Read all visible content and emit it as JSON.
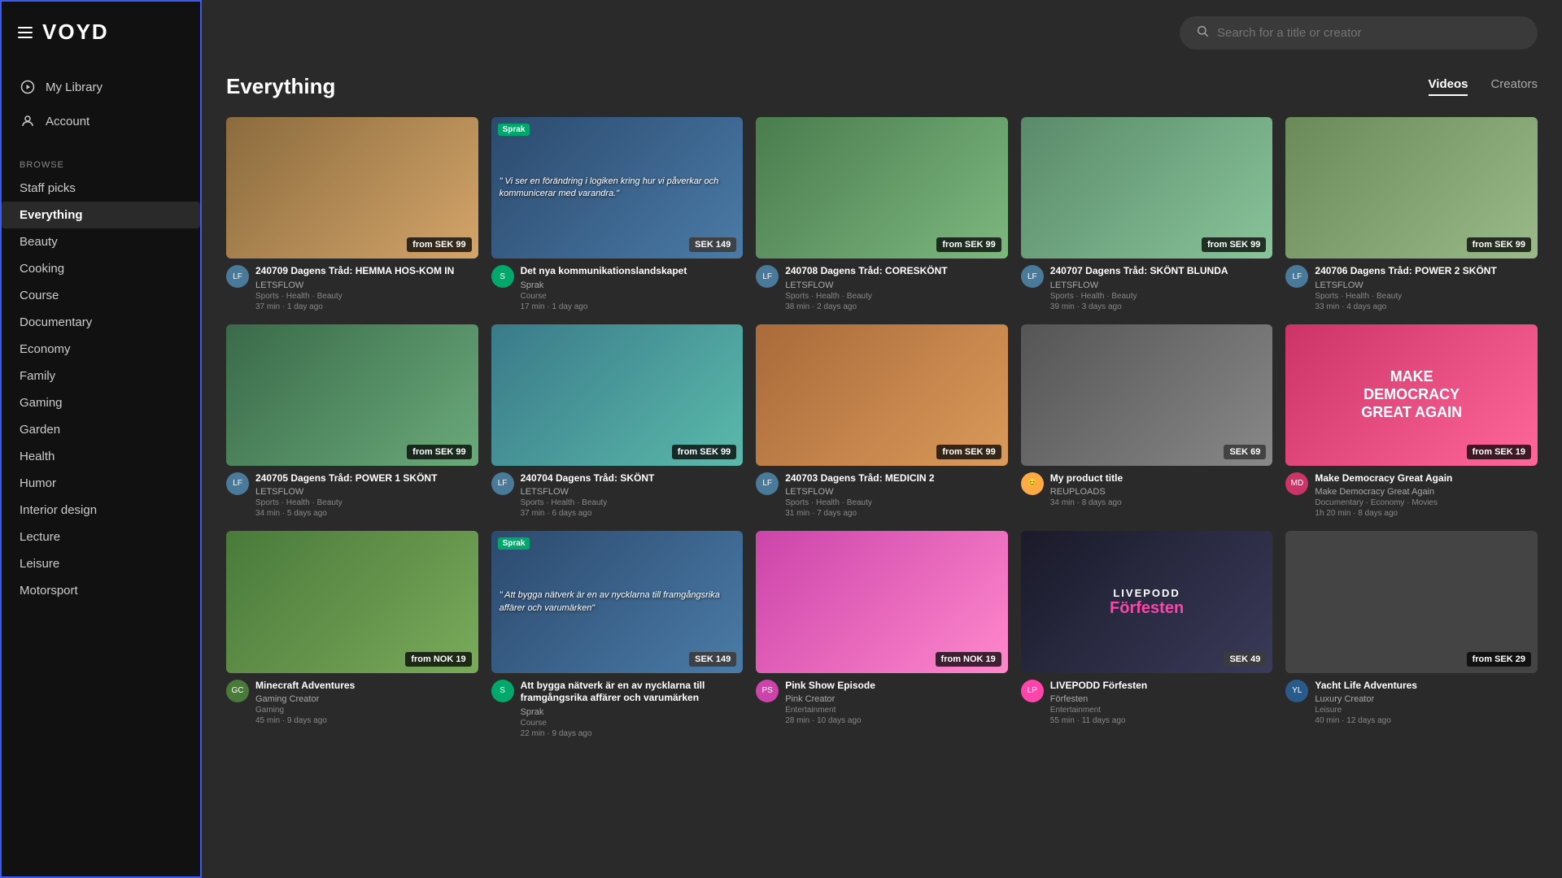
{
  "sidebar": {
    "logo": "VOYD",
    "nav": [
      {
        "id": "my-library",
        "label": "My Library",
        "icon": "play-circle"
      },
      {
        "id": "account",
        "label": "Account",
        "icon": "person"
      }
    ],
    "browse_label": "BROWSE",
    "categories": [
      {
        "id": "staff-picks",
        "label": "Staff picks",
        "active": false
      },
      {
        "id": "everything",
        "label": "Everything",
        "active": true
      },
      {
        "id": "beauty",
        "label": "Beauty",
        "active": false
      },
      {
        "id": "cooking",
        "label": "Cooking",
        "active": false
      },
      {
        "id": "course",
        "label": "Course",
        "active": false
      },
      {
        "id": "documentary",
        "label": "Documentary",
        "active": false
      },
      {
        "id": "economy",
        "label": "Economy",
        "active": false
      },
      {
        "id": "family",
        "label": "Family",
        "active": false
      },
      {
        "id": "gaming",
        "label": "Gaming",
        "active": false
      },
      {
        "id": "garden",
        "label": "Garden",
        "active": false
      },
      {
        "id": "health",
        "label": "Health",
        "active": false
      },
      {
        "id": "humor",
        "label": "Humor",
        "active": false
      },
      {
        "id": "interior-design",
        "label": "Interior design",
        "active": false
      },
      {
        "id": "lecture",
        "label": "Lecture",
        "active": false
      },
      {
        "id": "leisure",
        "label": "Leisure",
        "active": false
      },
      {
        "id": "motorsport",
        "label": "Motorsport",
        "active": false
      }
    ]
  },
  "header": {
    "search_placeholder": "Search for a title or creator"
  },
  "content": {
    "title": "Everything",
    "tabs": [
      {
        "id": "videos",
        "label": "Videos",
        "active": true
      },
      {
        "id": "creators",
        "label": "Creators",
        "active": false
      }
    ],
    "videos": [
      {
        "id": "v1",
        "title": "240709 Dagens Tråd: HEMMA HOS-KOM IN",
        "creator": "LETSFLOW",
        "tags": "Sports · Health · Beauty",
        "duration": "37 min",
        "ago": "1 day ago",
        "price": "from SEK 99",
        "thumb_type": "yoga1",
        "avatar_color": "#4a7a9a",
        "avatar_initials": "LF"
      },
      {
        "id": "v2",
        "title": "Det nya kommunikationslandskapet",
        "creator": "Sprak",
        "tags": "Course",
        "duration": "17 min",
        "ago": "1 day ago",
        "price": "SEK 149",
        "thumb_type": "talk",
        "avatar_color": "#00a86b",
        "avatar_initials": "S",
        "thumb_quote": "Vi ser en förändring i logiken kring hur vi påverkar och kommunicerar med varandra.",
        "has_sprak_logo": true
      },
      {
        "id": "v3",
        "title": "240708 Dagens Tråd: CORESKÖNT",
        "creator": "LETSFLOW",
        "tags": "Sports · Health · Beauty",
        "duration": "38 min",
        "ago": "2 days ago",
        "price": "from SEK 99",
        "thumb_type": "yoga2",
        "avatar_color": "#4a7a9a",
        "avatar_initials": "LF"
      },
      {
        "id": "v4",
        "title": "240707 Dagens Tråd: SKÖNT BLUNDA",
        "creator": "LETSFLOW",
        "tags": "Sports · Health · Beauty",
        "duration": "39 min",
        "ago": "3 days ago",
        "price": "from SEK 99",
        "thumb_type": "yoga3",
        "avatar_color": "#4a7a9a",
        "avatar_initials": "LF"
      },
      {
        "id": "v5",
        "title": "240706 Dagens Tråd: POWER 2 SKÖNT",
        "creator": "LETSFLOW",
        "tags": "Sports · Health · Beauty",
        "duration": "33 min",
        "ago": "4 days ago",
        "price": "from SEK 99",
        "thumb_type": "yoga4",
        "avatar_color": "#4a7a9a",
        "avatar_initials": "LF"
      },
      {
        "id": "v6",
        "title": "240705 Dagens Tråd: POWER 1 SKÖNT",
        "creator": "LETSFLOW",
        "tags": "Sports · Health · Beauty",
        "duration": "34 min",
        "ago": "5 days ago",
        "price": "from SEK 99",
        "thumb_type": "outdoor1",
        "avatar_color": "#4a7a9a",
        "avatar_initials": "LF"
      },
      {
        "id": "v7",
        "title": "240704 Dagens Tråd: SKÖNT",
        "creator": "LETSFLOW",
        "tags": "Sports · Health · Beauty",
        "duration": "37 min",
        "ago": "6 days ago",
        "price": "from SEK 99",
        "thumb_type": "outdoor2",
        "avatar_color": "#4a7a9a",
        "avatar_initials": "LF"
      },
      {
        "id": "v8",
        "title": "240703 Dagens Tråd: MEDICIN 2",
        "creator": "LETSFLOW",
        "tags": "Sports · Health · Beauty",
        "duration": "31 min",
        "ago": "7 days ago",
        "price": "from SEK 99",
        "thumb_type": "outdoor3",
        "avatar_color": "#4a7a9a",
        "avatar_initials": "LF"
      },
      {
        "id": "v9",
        "title": "My product title",
        "creator": "REUPLOADS",
        "tags": "",
        "duration": "34 min",
        "ago": "8 days ago",
        "price": "SEK 69",
        "thumb_type": "product",
        "avatar_color": "#ffaa44",
        "avatar_initials": "😊"
      },
      {
        "id": "v10",
        "title": "Make Democracy Great Again",
        "creator": "Make Democracy Great Again",
        "tags": "Documentary · Economy · Movies",
        "duration": "1h 20 min",
        "ago": "8 days ago",
        "price": "from SEK 19",
        "thumb_type": "democracy",
        "avatar_color": "#cc3366",
        "avatar_initials": "MD"
      },
      {
        "id": "v11",
        "title": "Minecraft Adventures",
        "creator": "Gaming Creator",
        "tags": "Gaming",
        "duration": "45 min",
        "ago": "9 days ago",
        "price": "from NOK 19",
        "thumb_type": "minecraft",
        "avatar_color": "#4a7a3a",
        "avatar_initials": "GC"
      },
      {
        "id": "v12",
        "title": "Att bygga nätverk är en av nycklarna till framgångsrika affärer och varumärken",
        "creator": "Sprak",
        "tags": "Course",
        "duration": "22 min",
        "ago": "9 days ago",
        "price": "SEK 149",
        "thumb_type": "network",
        "avatar_color": "#00a86b",
        "avatar_initials": "S",
        "thumb_quote": "Att bygga nätverk är en av nycklarna till framgångsrika affärer och varumärken",
        "has_sprak_logo": true
      },
      {
        "id": "v13",
        "title": "Pink Show Episode",
        "creator": "Pink Creator",
        "tags": "Entertainment",
        "duration": "28 min",
        "ago": "10 days ago",
        "price": "from NOK 19",
        "thumb_type": "pink",
        "avatar_color": "#cc44aa",
        "avatar_initials": "PS"
      },
      {
        "id": "v14",
        "title": "LIVEPODD Förfesten",
        "creator": "Förfesten",
        "tags": "Entertainment",
        "duration": "55 min",
        "ago": "11 days ago",
        "price": "SEK 49",
        "thumb_type": "livepodd",
        "avatar_color": "#ff44aa",
        "avatar_initials": "LP"
      },
      {
        "id": "v15",
        "title": "Yacht Life Adventures",
        "creator": "Luxury Creator",
        "tags": "Leisure",
        "duration": "40 min",
        "ago": "12 days ago",
        "price": "from SEK 29",
        "thumb_type": "yacht",
        "avatar_color": "#2a5a8a",
        "avatar_initials": "YL"
      }
    ]
  }
}
